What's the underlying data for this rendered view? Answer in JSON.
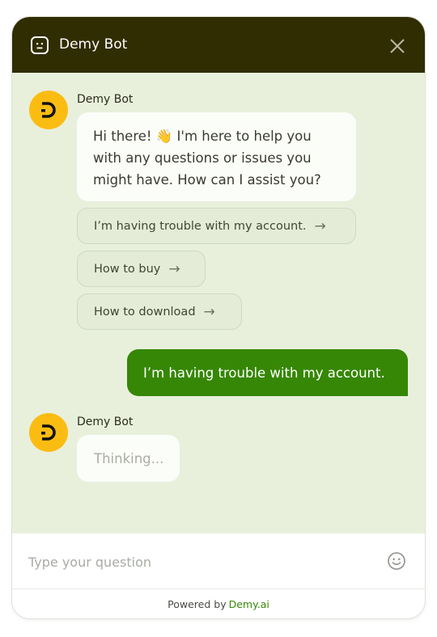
{
  "header": {
    "title": "Demy Bot",
    "bot_icon": "bot-face-icon",
    "close_icon": "close-icon"
  },
  "messages": [
    {
      "sender": "Demy Bot",
      "text": "Hi there! 👋 I'm here to help you with any questions or issues you might have. How can I assist you?"
    },
    {
      "sender": "user",
      "text": "I’m having trouble with my account."
    },
    {
      "sender": "Demy Bot",
      "text": "Thinking..."
    }
  ],
  "quick_replies": [
    "I’m having trouble with my account.",
    "How to buy",
    "How to download"
  ],
  "input": {
    "placeholder": "Type your question",
    "value": "",
    "emoji_icon": "smiley-icon"
  },
  "footer": {
    "powered_by": "Powered by",
    "brand": "Demy.ai"
  },
  "colors": {
    "header_bg": "#302d02",
    "chat_bg": "#e8f0dc",
    "user_bubble": "#368705",
    "avatar": "#fbbc12",
    "brand_link": "#368705"
  }
}
